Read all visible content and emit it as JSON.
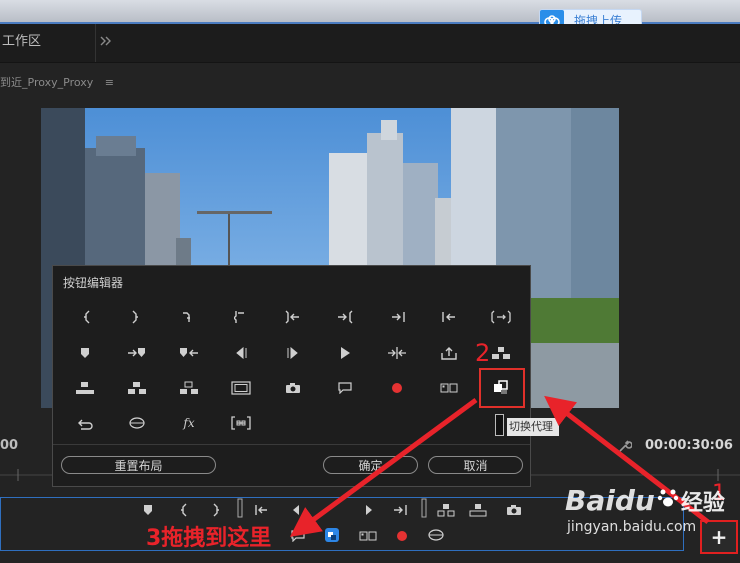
{
  "window": {
    "upload_button": {
      "label": "拖拽上传",
      "icon": "cloud-upload-icon"
    }
  },
  "workspace": {
    "tab_label": "工作区",
    "more_icon": "double-chevron-right-icon"
  },
  "panel": {
    "title": "到近_Proxy_Proxy",
    "menu_icon": "hamburger-icon"
  },
  "button_editor": {
    "title": "按钮编辑器",
    "rows": [
      [
        "mark-in-icon",
        "mark-out-icon",
        "clear-in-icon",
        "clear-out-icon",
        "go-to-in-icon",
        "go-to-out-icon",
        "go-to-next-edit-icon",
        "go-to-prev-edit-icon",
        "go-to-in-out-icon"
      ],
      [
        "add-marker-icon",
        "go-to-next-marker-icon",
        "go-to-prev-marker-icon",
        "step-back-icon",
        "step-forward-icon",
        "play-icon",
        "shuttle-icon",
        "export-frame-icon",
        "lift-icon"
      ],
      [
        "insert-icon",
        "overwrite-icon",
        "extract-icon",
        "safe-margins-icon",
        "camera-icon",
        "comment-icon",
        "record-icon",
        "multicam-icon",
        "toggle-proxy-icon"
      ],
      [
        "loop-icon",
        "vr-video-icon",
        "fx-icon",
        "compare-view-icon"
      ]
    ],
    "reset_label": "重置布局",
    "ok_label": "确定",
    "cancel_label": "取消",
    "tooltip": "切换代理"
  },
  "timeline": {
    "timecode_left": "00",
    "timecode_right": "00:00:30:06",
    "wrench_icon": "wrench-icon"
  },
  "transport": {
    "icons_row1": [
      "add-marker-icon",
      "mark-in-icon",
      "mark-out-icon",
      "divider",
      "go-to-in-icon",
      "step-back-icon",
      "play-icon",
      "step-forward-icon",
      "go-to-out-icon",
      "divider",
      "insert-icon",
      "overwrite-icon",
      "export-frame-icon"
    ],
    "icons_row2": [
      "comment-icon",
      "toggle-proxy-icon",
      "multicam-icon",
      "record-icon",
      "vr-video-icon"
    ],
    "add_button_label": "+"
  },
  "annotations": {
    "step1": "1",
    "step2": "2",
    "step3": "3拖拽到这里",
    "accent_color": "#e8232a"
  },
  "watermark": {
    "brand": "Baidu",
    "suffix": "经验",
    "url": "jingyan.baidu.com"
  }
}
